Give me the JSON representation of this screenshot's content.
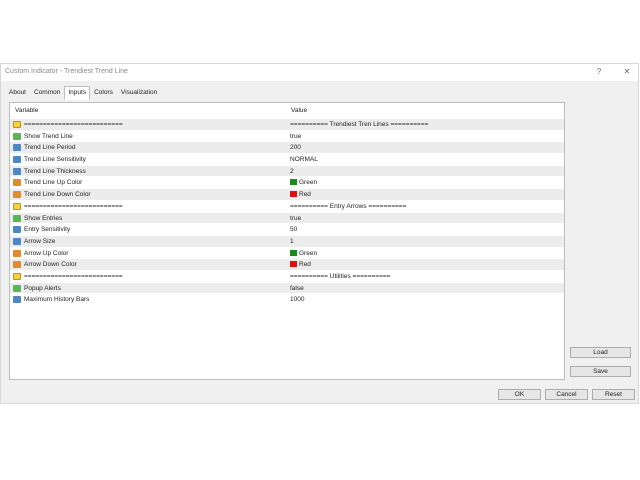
{
  "window": {
    "title": "Custom Indicator - Trendiest Trend Line",
    "help_label": "?",
    "close_label": "✕"
  },
  "tabs": [
    {
      "label": "About"
    },
    {
      "label": "Common"
    },
    {
      "label": "Inputs"
    },
    {
      "label": "Colors"
    },
    {
      "label": "Visualization"
    }
  ],
  "active_tab": "Inputs",
  "table": {
    "col_variable": "Variable",
    "col_value": "Value",
    "rows": [
      {
        "icon": "ab-icon",
        "name": "==========================",
        "value": "========== Trendiest Tren Lines =========="
      },
      {
        "icon": "bool-icon",
        "name": "Show Trend Line",
        "value": "true"
      },
      {
        "icon": "number-icon",
        "name": "Trend Line Period",
        "value": "200"
      },
      {
        "icon": "enum-icon",
        "name": "Trend Line Sensitivity",
        "value": "NORMAL"
      },
      {
        "icon": "number-icon",
        "name": "Trend Line Thickness",
        "value": "2"
      },
      {
        "icon": "color-icon",
        "name": "Trend Line Up Color",
        "value": "Green",
        "swatch": "#1a8a1a"
      },
      {
        "icon": "color-icon",
        "name": "Trend Line Down Color",
        "value": "Red",
        "swatch": "#e01010"
      },
      {
        "icon": "ab-icon",
        "name": "==========================",
        "value": "========== Entry Arrows =========="
      },
      {
        "icon": "bool-icon",
        "name": "Show Entries",
        "value": "true"
      },
      {
        "icon": "number-icon",
        "name": "Entry Sensitivity",
        "value": "50"
      },
      {
        "icon": "number-icon",
        "name": "Arrow Size",
        "value": "1"
      },
      {
        "icon": "color-icon",
        "name": "Arrow Up Color",
        "value": "Green",
        "swatch": "#1a8a1a"
      },
      {
        "icon": "color-icon",
        "name": "Arrow Down Color",
        "value": "Red",
        "swatch": "#e01010"
      },
      {
        "icon": "ab-icon",
        "name": "==========================",
        "value": "========== Utilities =========="
      },
      {
        "icon": "bool-icon",
        "name": "Popup Alerts",
        "value": "false"
      },
      {
        "icon": "number-icon",
        "name": "Maximum History Bars",
        "value": "1000"
      }
    ]
  },
  "buttons": {
    "load": "Load",
    "save": "Save",
    "ok": "OK",
    "cancel": "Cancel",
    "reset": "Reset"
  }
}
